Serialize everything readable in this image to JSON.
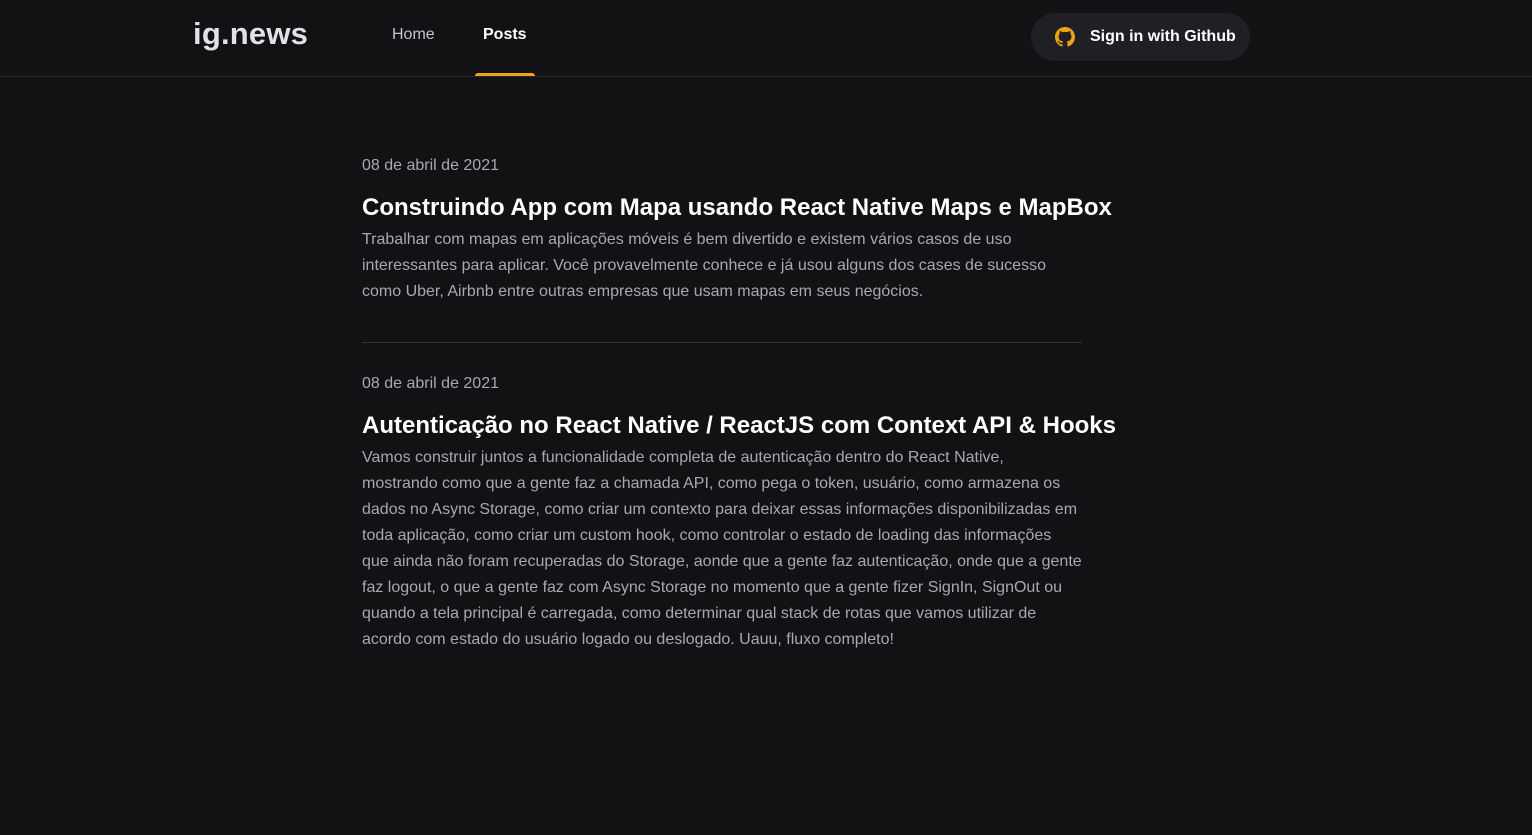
{
  "header": {
    "logo": "ig.news",
    "nav": [
      {
        "label": "Home",
        "active": false
      },
      {
        "label": "Posts",
        "active": true
      }
    ],
    "signin_label": "Sign in with Github",
    "accent_color": "#eba417"
  },
  "posts": [
    {
      "date": "08 de abril de 2021",
      "title": "Construindo App com Mapa usando React Native Maps e MapBox",
      "excerpt": "Trabalhar com mapas em aplicações móveis é bem divertido e existem vários casos de uso\ninteressantes para aplicar. Você provavelmente conhece e já usou alguns dos cases de sucesso\ncomo Uber, Airbnb entre outras empresas que usam mapas em seus negócios."
    },
    {
      "date": "08 de abril de 2021",
      "title": "Autenticação no React Native / ReactJS com Context API & Hooks",
      "excerpt": "Vamos construir juntos a funcionalidade completa de autenticação dentro do React Native,\nmostrando como que a gente faz a chamada API, como pega o token, usuário, como armazena os\ndados no Async Storage, como criar um contexto para deixar essas informações disponibilizadas em\ntoda aplicação, como  criar um custom hook, como controlar o estado de loading das informações\nque ainda não foram recuperadas do Storage, aonde que a gente faz autenticação, onde que a gente\nfaz logout,  o que a gente faz com Async Storage no momento que a gente fizer SignIn, SignOut ou\nquando a tela principal é carregada, como determinar qual stack de rotas que vamos utilizar de\nacordo com estado do usuário logado ou deslogado. Uauu, fluxo completo!"
    }
  ]
}
